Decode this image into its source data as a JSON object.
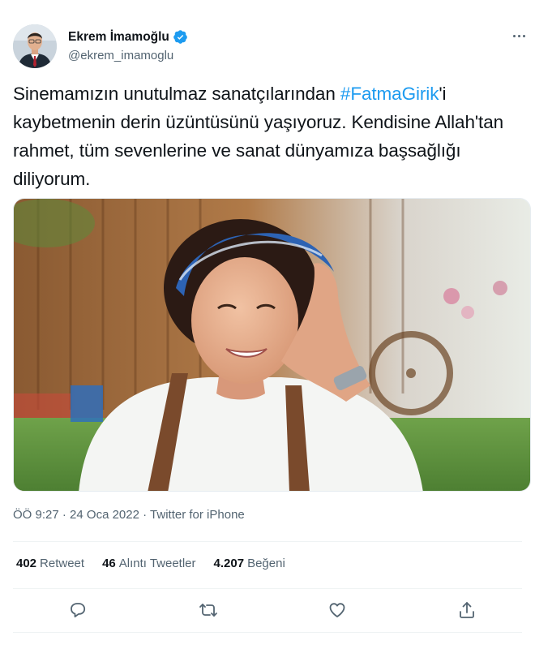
{
  "author": {
    "display_name": "Ekrem İmamoğlu",
    "handle": "@ekrem_imamoglu",
    "verified": true
  },
  "tweet": {
    "text_before": "Sinemamızın unutulmaz sanatçılarından ",
    "hashtag": "#FatmaGirik",
    "text_after": "'i kaybetmenin derin üzüntüsünü yaşıyoruz. Kendisine Allah'tan rahmet, tüm sevenlerine ve sanat dünyamıza başsağlığı diliyorum."
  },
  "meta": {
    "time": "ÖÖ 9:27",
    "date": "24 Oca 2022",
    "separator": "·",
    "source": "Twitter for iPhone"
  },
  "stats": {
    "retweets": {
      "count": "402",
      "label": "Retweet"
    },
    "quotes": {
      "count": "46",
      "label": "Alıntı Tweetler"
    },
    "likes": {
      "count": "4.207",
      "label": "Beğeni"
    }
  },
  "colors": {
    "accent": "#1d9bf0",
    "text": "#0f1419",
    "secondary": "#536471",
    "divider": "#eff3f4"
  },
  "icons": {
    "more": "more-horizontal-icon",
    "verified": "verified-badge-icon",
    "reply": "reply-icon",
    "retweet": "retweet-icon",
    "like": "heart-icon",
    "share": "share-icon"
  }
}
